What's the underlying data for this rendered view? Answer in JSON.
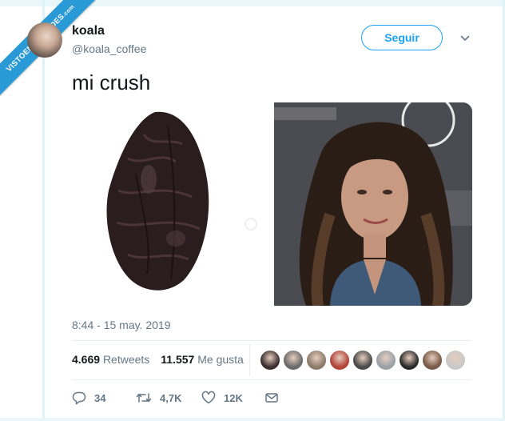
{
  "watermark": {
    "text": "VISTOENLASREDES",
    "sub": ".com"
  },
  "user": {
    "name": "koala",
    "handle": "@koala_coffee"
  },
  "follow_label": "Seguir",
  "tweet": {
    "text": "mi crush",
    "timestamp": "8:44 - 15 may. 2019"
  },
  "stats": {
    "retweets_count": "4.669",
    "retweets_label": "Retweets",
    "likes_count": "11.557",
    "likes_label": "Me gusta"
  },
  "actions": {
    "replies": "34",
    "retweets": "4,7K",
    "likes": "12K"
  },
  "likers": [
    "#3b2f2f",
    "#6b6b6b",
    "#8c7b6b",
    "#b3443a",
    "#4a4a4a",
    "#9aa2a8",
    "#2b2b2b",
    "#7a5a48",
    "#c9c9c9"
  ],
  "colors": {
    "accent": "#1da1f2",
    "secondary_text": "#657786",
    "ribbon": "#2a9ad6"
  }
}
